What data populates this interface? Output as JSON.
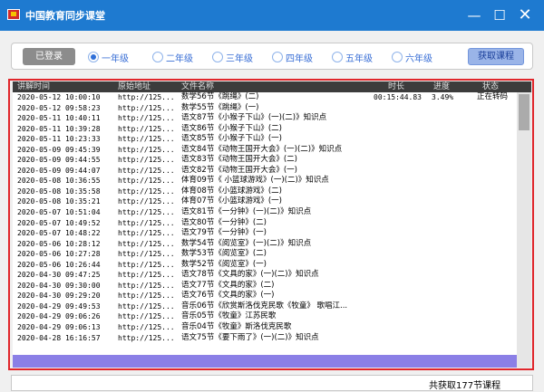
{
  "window": {
    "title": "中国教育同步课堂",
    "min_glyph": "—",
    "max_glyph": "☐",
    "close_glyph": "✕"
  },
  "toolbar": {
    "login_label": "已登录",
    "grades": [
      "一年级",
      "二年级",
      "三年级",
      "四年级",
      "五年级",
      "六年级"
    ],
    "selected_grade": "一年级",
    "fetch_label": "获取课程"
  },
  "table": {
    "columns": [
      "讲解时间",
      "原始地址",
      "文件名称",
      "时长",
      "进度",
      "状态"
    ],
    "rows": [
      {
        "time": "2020-05-12 10:00:10",
        "url": "http://125...",
        "name": "数学56节《跳绳》(二)",
        "duration": "00:15:44.83",
        "progress": "3.49%",
        "status": "正在转码"
      },
      {
        "time": "2020-05-12 09:58:23",
        "url": "http://125...",
        "name": "数学55节《跳绳》(一)",
        "duration": "",
        "progress": "",
        "status": ""
      },
      {
        "time": "2020-05-11 10:40:11",
        "url": "http://125...",
        "name": "语文87节《小猴子下山》(一)(二)》知识点",
        "duration": "",
        "progress": "",
        "status": ""
      },
      {
        "time": "2020-05-11 10:39:28",
        "url": "http://125...",
        "name": "语文86节《小猴子下山》(二)",
        "duration": "",
        "progress": "",
        "status": ""
      },
      {
        "time": "2020-05-11 10:23:33",
        "url": "http://125...",
        "name": "语文85节《小猴子下山》(一)",
        "duration": "",
        "progress": "",
        "status": ""
      },
      {
        "time": "2020-05-09 09:45:39",
        "url": "http://125...",
        "name": "语文84节《动物王国开大会》(一)(二)》知识点",
        "duration": "",
        "progress": "",
        "status": ""
      },
      {
        "time": "2020-05-09 09:44:55",
        "url": "http://125...",
        "name": "语文83节《动物王国开大会》(二)",
        "duration": "",
        "progress": "",
        "status": ""
      },
      {
        "time": "2020-05-09 09:44:07",
        "url": "http://125...",
        "name": "语文82节《动物王国开大会》(一)",
        "duration": "",
        "progress": "",
        "status": ""
      },
      {
        "time": "2020-05-08 10:36:55",
        "url": "http://125...",
        "name": "体育09节《 小篮球游戏》(一)(二)》知识点",
        "duration": "",
        "progress": "",
        "status": ""
      },
      {
        "time": "2020-05-08 10:35:58",
        "url": "http://125...",
        "name": "体育08节《小篮球游戏》(二)",
        "duration": "",
        "progress": "",
        "status": ""
      },
      {
        "time": "2020-05-08 10:35:21",
        "url": "http://125...",
        "name": "体育07节《小篮球游戏》(一)",
        "duration": "",
        "progress": "",
        "status": ""
      },
      {
        "time": "2020-05-07 10:51:04",
        "url": "http://125...",
        "name": "语文81节《一分钟》(一)(二)》知识点",
        "duration": "",
        "progress": "",
        "status": ""
      },
      {
        "time": "2020-05-07 10:49:52",
        "url": "http://125...",
        "name": "语文80节《一分钟》(二)",
        "duration": "",
        "progress": "",
        "status": ""
      },
      {
        "time": "2020-05-07 10:48:22",
        "url": "http://125...",
        "name": "语文79节《一分钟》(一)",
        "duration": "",
        "progress": "",
        "status": ""
      },
      {
        "time": "2020-05-06 10:28:12",
        "url": "http://125...",
        "name": "数学54节《阅览室》(一)(二)》知识点",
        "duration": "",
        "progress": "",
        "status": ""
      },
      {
        "time": "2020-05-06 10:27:28",
        "url": "http://125...",
        "name": "数学53节《阅览室》(二)",
        "duration": "",
        "progress": "",
        "status": ""
      },
      {
        "time": "2020-05-06 10:26:44",
        "url": "http://125...",
        "name": "数学52节《阅览室》(一)",
        "duration": "",
        "progress": "",
        "status": ""
      },
      {
        "time": "2020-04-30 09:47:25",
        "url": "http://125...",
        "name": "语文78节《文具的家》(一)(二)》知识点",
        "duration": "",
        "progress": "",
        "status": ""
      },
      {
        "time": "2020-04-30 09:30:00",
        "url": "http://125...",
        "name": "语文77节《文具的家》(二)",
        "duration": "",
        "progress": "",
        "status": ""
      },
      {
        "time": "2020-04-30 09:29:20",
        "url": "http://125...",
        "name": "语文76节《文具的家》(一)",
        "duration": "",
        "progress": "",
        "status": ""
      },
      {
        "time": "2020-04-29 09:49:53",
        "url": "http://125...",
        "name": "音乐06节《欣赏斯洛伐克民歌《牧童》 歌唱江...",
        "duration": "",
        "progress": "",
        "status": ""
      },
      {
        "time": "2020-04-29 09:06:26",
        "url": "http://125...",
        "name": "音乐05节《牧童》江苏民歌",
        "duration": "",
        "progress": "",
        "status": ""
      },
      {
        "time": "2020-04-29 09:06:13",
        "url": "http://125...",
        "name": "音乐04节《牧童》斯洛伐克民歌",
        "duration": "",
        "progress": "",
        "status": ""
      },
      {
        "time": "2020-04-28 16:16:57",
        "url": "http://125...",
        "name": "语文75节《要下雨了》(一)(二)》知识点",
        "duration": "",
        "progress": "",
        "status": ""
      }
    ]
  },
  "status": {
    "summary": "共获取177节课程"
  },
  "scroll": {
    "vertical_position": 0,
    "horizontal_visible_fraction": 1.0
  }
}
